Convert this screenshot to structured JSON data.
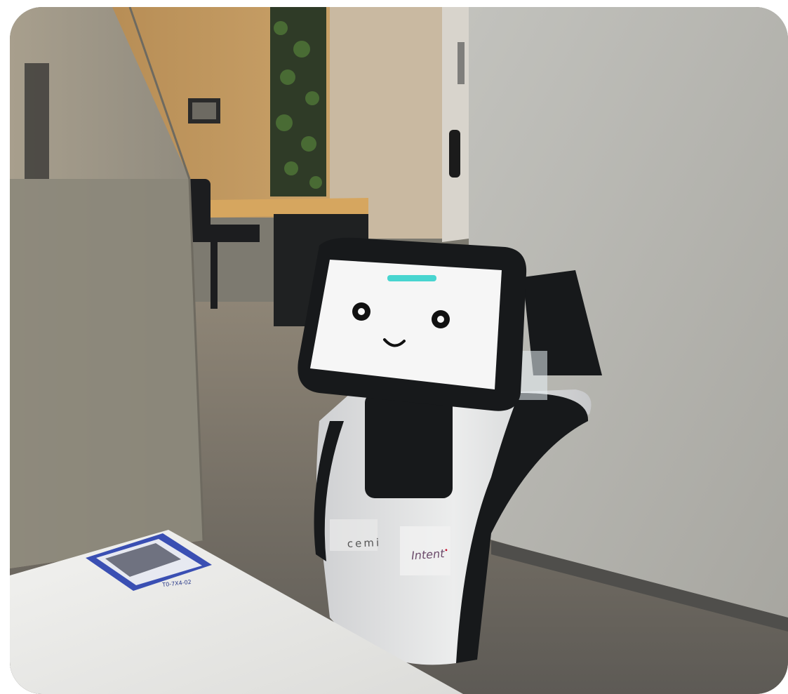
{
  "scene": {
    "colors": {
      "wall_concrete": "#b9b8b2",
      "wall_cork": "#c8a268",
      "floor": "#7e7a70",
      "table_top": "#e9e8e6",
      "robot_body": "#e2e3e5",
      "robot_black": "#17191b",
      "screen_face": "#f7f7f7",
      "eyebrow_accent": "#48d5d0",
      "qr_sticker": "#3a4fb3"
    },
    "robot": {
      "body_logo_left": "cemi",
      "body_logo_right": "Intent",
      "body_logo_right_mark": "•"
    },
    "qr_sticker": {
      "caption": "T0-7X4-02"
    }
  }
}
